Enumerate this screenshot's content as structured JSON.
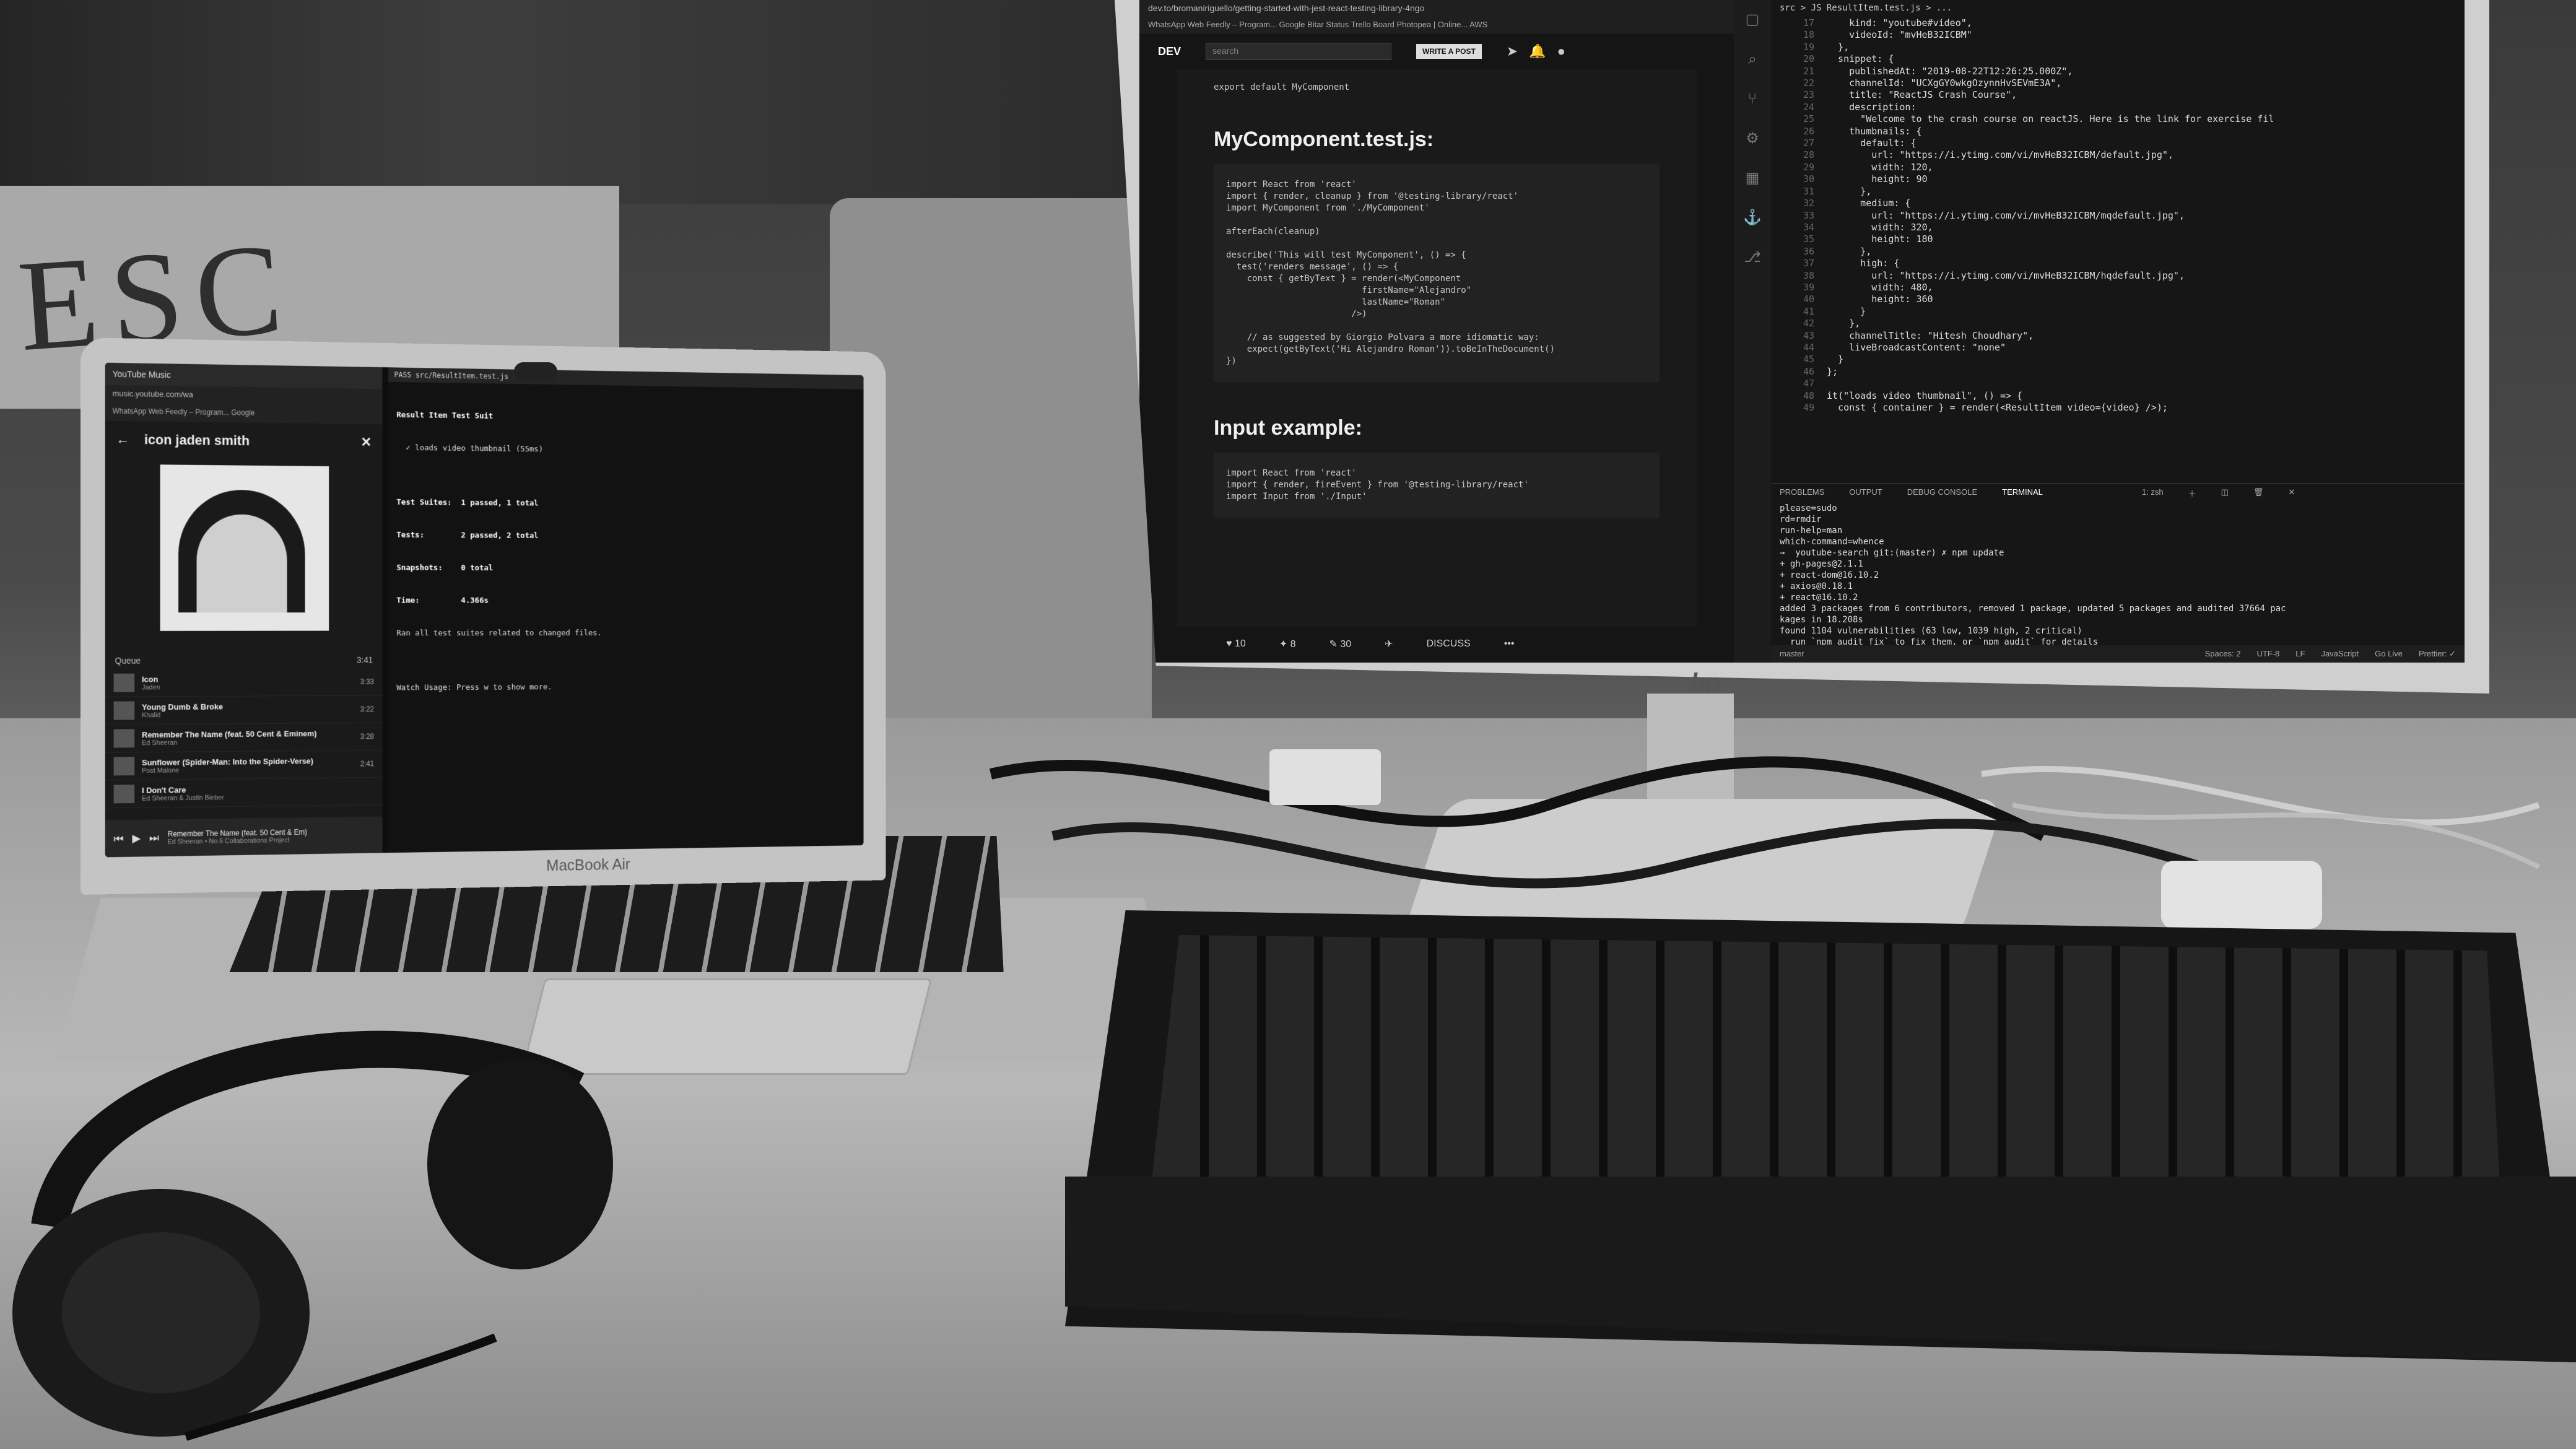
{
  "laptop": {
    "brand": "MacBook Air",
    "music": {
      "tab_title": "YouTube Music",
      "url": "music.youtube.com/wa",
      "bookmarks": "WhatsApp Web   Feedly – Program...   Google",
      "header_title": "icon jaden smith",
      "queue_label": "Queue",
      "queue_duration": "3:41",
      "tracks": [
        {
          "title": "Icon",
          "artist": "Jaden",
          "duration": "3:33"
        },
        {
          "title": "Young Dumb & Broke",
          "artist": "Khalid",
          "duration": "3:22"
        },
        {
          "title": "Remember The Name (feat. 50 Cent & Eminem)",
          "artist": "Ed Sheeran",
          "duration": "3:28"
        },
        {
          "title": "Sunflower (Spider-Man: Into the Spider-Verse)",
          "artist": "Post Malone",
          "duration": "2:41"
        },
        {
          "title": "I Don't Care",
          "artist": "Ed Sheeran & Justin Bieber",
          "duration": ""
        }
      ],
      "now_playing": "Remember The Name (feat. 50 Cent & Em)",
      "now_playing_artist": "Ed Sheeran • No.6 Collaborations Project"
    },
    "terminal": {
      "tab": "PASS  src/ResultItem.test.js",
      "lines": [
        "Result Item Test Suit",
        "  ✓ loads video thumbnail (55ms)",
        "",
        "Test Suites:  1 passed, 1 total",
        "Tests:        2 passed, 2 total",
        "Snapshots:    0 total",
        "Time:         4.366s",
        "Ran all test suites related to changed files.",
        "",
        "Watch Usage: Press w to show more."
      ]
    }
  },
  "monitor": {
    "logo": "hp",
    "browser": {
      "url": "dev.to/bromaniriguello/getting-started-with-jest-react-testing-library-4ngo",
      "bookmarks": "WhatsApp Web   Feedly – Program...   Google   Bitar Status   Trello Board   Photopea | Online...   AWS",
      "site_logo": "DEV",
      "search_placeholder": "search",
      "write_button": "WRITE A POST",
      "export_line": "export default MyComponent",
      "heading_1": "MyComponent.test.js:",
      "code_1": "import React from 'react'\nimport { render, cleanup } from '@testing-library/react'\nimport MyComponent from './MyComponent'\n\nafterEach(cleanup)\n\ndescribe('This will test MyComponent', () => {\n  test('renders message', () => {\n    const { getByText } = render(<MyComponent\n                          firstName=\"Alejandro\"\n                          lastName=\"Roman\"\n                        />)\n\n    // as suggested by Giorgio Polvara a more idiomatic way:\n    expect(getByText('Hi Alejandro Roman')).toBeInTheDocument()\n})",
      "heading_2": "Input example:",
      "code_2": "import React from 'react'\nimport { render, fireEvent } from '@testing-library/react'\nimport Input from './Input'",
      "reactions": {
        "likes": "10",
        "unicorns": "8",
        "saves": "30",
        "share": "DISCUSS"
      }
    },
    "editor": {
      "tab": "src  >  JS ResultItem.test.js  >  ...",
      "line_start": 17,
      "code": "    kind: \"youtube#video\",\n    videoId: \"mvHeB32ICBM\"\n  },\n  snippet: {\n    publishedAt: \"2019-08-22T12:26:25.000Z\",\n    channelId: \"UCXgGY0wkgOzynnHvSEVmE3A\",\n    title: \"ReactJS Crash Course\",\n    description:\n      \"Welcome to the crash course on reactJS. Here is the link for exercise fil\n    thumbnails: {\n      default: {\n        url: \"https://i.ytimg.com/vi/mvHeB32ICBM/default.jpg\",\n        width: 120,\n        height: 90\n      },\n      medium: {\n        url: \"https://i.ytimg.com/vi/mvHeB32ICBM/mqdefault.jpg\",\n        width: 320,\n        height: 180\n      },\n      high: {\n        url: \"https://i.ytimg.com/vi/mvHeB32ICBM/hqdefault.jpg\",\n        width: 480,\n        height: 360\n      }\n    },\n    channelTitle: \"Hitesh Choudhary\",\n    liveBroadcastContent: \"none\"\n  }\n};\n\nit(\"loads video thumbnail\", () => {\n  const { container } = render(<ResultItem video={video} />);",
      "panel_tabs": [
        "PROBLEMS",
        "OUTPUT",
        "DEBUG CONSOLE",
        "TERMINAL",
        "1: zsh"
      ],
      "terminal": "please=sudo\nrd=rmdir\nrun-help=man\nwhich-command=whence\n→  youtube-search git:(master) ✗ npm update\n+ gh-pages@2.1.1\n+ react-dom@16.10.2\n+ axios@0.18.1\n+ react@16.10.2\nadded 3 packages from 6 contributors, removed 1 package, updated 5 packages and audited 37664 pac\nkages in 18.208s\nfound 1104 vulnerabilities (63 low, 1039 high, 2 critical)\n  run `npm audit fix` to fix them, or `npm audit` for details\n→  youtube-search git:(master) ✗ ▋",
      "status": [
        "Spaces: 2",
        "UTF-8",
        "LF",
        "JavaScript",
        "Go Live",
        "Prettier: ✓"
      ],
      "branch": "master"
    }
  },
  "whiteboard_text": "ESC"
}
